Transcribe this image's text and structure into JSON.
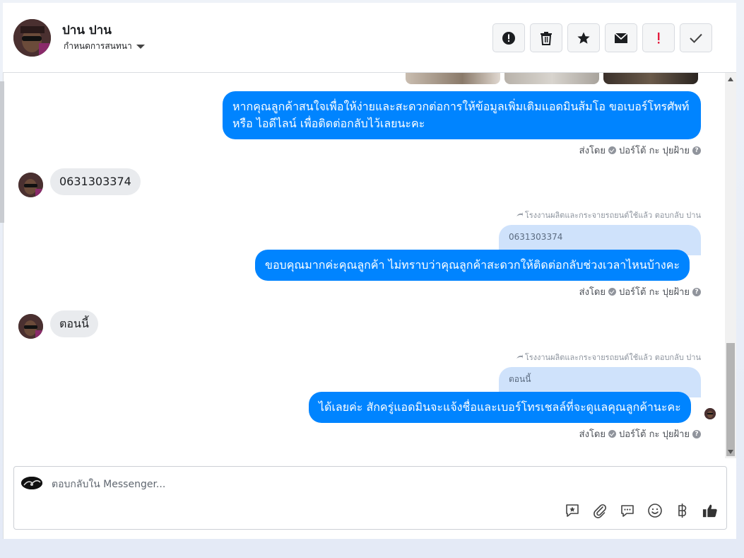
{
  "header": {
    "contact_name": "ปาน ปาน",
    "label_picker": "กำหนดการสนทนา",
    "actions": [
      {
        "name": "mark-spam-button",
        "icon": "alert-circle-icon"
      },
      {
        "name": "delete-button",
        "icon": "trash-icon"
      },
      {
        "name": "star-button",
        "icon": "star-icon"
      },
      {
        "name": "mark-unread-button",
        "icon": "envelope-icon"
      },
      {
        "name": "follow-up-button",
        "icon": "exclamation-icon"
      },
      {
        "name": "mark-done-button",
        "icon": "check-icon"
      }
    ]
  },
  "messages": {
    "m1_text": "หากคุณลูกค้าสนใจเพื่อให้ง่ายและสะดวกต่อการให้ข้อมูลเพิ่มเติมแอดมินส้มโอ ขอเบอร์โทรศัพท์ หรือ ไอดีไลน์ เพื่อติดต่อกลับไว้เลยนะคะ",
    "m2_text": "0631303374",
    "m3_reply_note": "โรงงานผลิตและกระจายรถยนต์ใช้แล้ว ตอบกลับ ปาน",
    "m3_quote": "0631303374",
    "m3_text": "ขอบคุณมากค่ะคุณลูกค้า ไม่ทราบว่าคุณลูกค้าสะดวกให้ติดต่อกลับช่วงเวลาไหนบ้างคะ",
    "m4_text": "ตอนนี้",
    "m5_reply_note": "โรงงานผลิตและกระจายรถยนต์ใช้แล้ว ตอบกลับ ปาน",
    "m5_quote": "ตอนนี้",
    "m5_text": "ได้เลยค่ะ สักครู่แอดมินจะแจ้งชื่อและเบอร์โทรเชลล์ที่จะดูแลคุณลูกค้านะคะ",
    "sent_by_label": "ส่งโดย",
    "sent_by_name": "ปอร์โต้ กะ ปุยฝ้าย"
  },
  "composer": {
    "placeholder": "ตอบกลับใน Messenger...",
    "tools": [
      "saved-reply-icon",
      "attachment-icon",
      "chat-bubble-icon",
      "emoji-icon",
      "baht-icon",
      "thumbs-up-icon"
    ]
  },
  "colors": {
    "outgoing_bubble": "#0084ff",
    "incoming_bubble": "#e9ebee",
    "quote_bubble": "#cfe2fb",
    "follow_up_red": "#e41e3f"
  }
}
